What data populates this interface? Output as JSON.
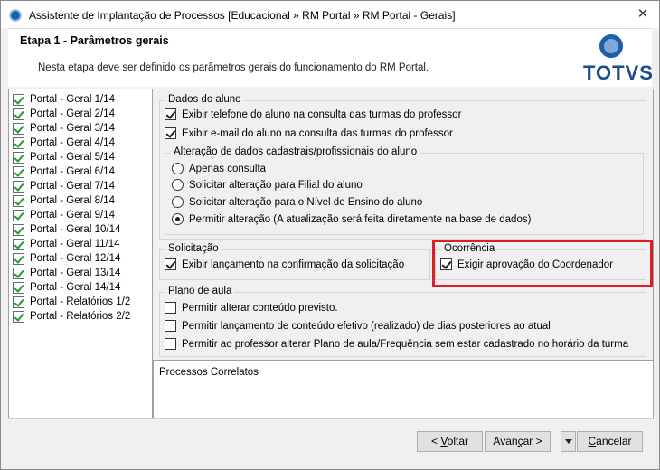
{
  "window": {
    "title": "Assistente de Implantação de Processos [Educacional » RM Portal » RM Portal - Gerais]",
    "close_glyph": "✕"
  },
  "header": {
    "step_title": "Etapa 1 - Parâmetros gerais",
    "description": "Nesta etapa deve ser definido os parâmetros gerais do funcionamento do RM Portal.",
    "logo_text": "TOTVS"
  },
  "tree": {
    "items": [
      {
        "label": "Portal - Geral 1/14"
      },
      {
        "label": "Portal - Geral 2/14"
      },
      {
        "label": "Portal - Geral 3/14"
      },
      {
        "label": "Portal - Geral 4/14"
      },
      {
        "label": "Portal - Geral 5/14"
      },
      {
        "label": "Portal - Geral 6/14"
      },
      {
        "label": "Portal - Geral 7/14"
      },
      {
        "label": "Portal - Geral 8/14"
      },
      {
        "label": "Portal - Geral 9/14"
      },
      {
        "label": "Portal - Geral 10/14"
      },
      {
        "label": "Portal - Geral 11/14"
      },
      {
        "label": "Portal - Geral 12/14"
      },
      {
        "label": "Portal - Geral 13/14"
      },
      {
        "label": "Portal - Geral 14/14"
      },
      {
        "label": "Portal - Relatórios 1/2"
      },
      {
        "label": "Portal - Relatórios 2/2"
      }
    ]
  },
  "dados_aluno": {
    "legend": "Dados do aluno",
    "checks": [
      {
        "label": "Exibir telefone do aluno na consulta das turmas do professor",
        "checked": true
      },
      {
        "label": "Exibir e-mail do aluno na consulta das turmas do professor",
        "checked": true
      }
    ],
    "alteracao": {
      "legend": "Alteração de dados cadastrais/profissionais do aluno",
      "options": [
        {
          "label": "Apenas consulta",
          "checked": false
        },
        {
          "label": "Solicitar alteração para Filial do aluno",
          "checked": false
        },
        {
          "label": "Solicitar alteração para o Nível de Ensino do aluno",
          "checked": false
        },
        {
          "label": "Permitir alteração (A atualização será feita diretamente na base de dados)",
          "checked": true
        }
      ]
    }
  },
  "solicitacao": {
    "legend": "Solicitação",
    "check": {
      "label": "Exibir lançamento na confirmação da solicitação",
      "checked": true
    }
  },
  "ocorrencia": {
    "legend": "Ocorrência",
    "check": {
      "label": "Exigir aprovação do Coordenador",
      "checked": true
    },
    "highlight_color": "#e01d25"
  },
  "plano_aula": {
    "legend": "Plano de aula",
    "checks": [
      {
        "label": "Permitir alterar conteúdo previsto.",
        "checked": false
      },
      {
        "label": "Permitir lançamento de conteúdo efetivo (realizado) de dias posteriores ao atual",
        "checked": false
      },
      {
        "label": "Permitir ao professor alterar Plano de aula/Frequência sem estar cadastrado no horário da turma",
        "checked": false
      }
    ]
  },
  "related": {
    "title": "Processos Correlatos"
  },
  "footer": {
    "back_prefix": "< ",
    "back_key": "V",
    "back_rest": "oltar",
    "next_prefix": "Avan",
    "next_key": "ç",
    "next_rest": "ar >",
    "cancel_key": "C",
    "cancel_rest": "ancelar"
  }
}
